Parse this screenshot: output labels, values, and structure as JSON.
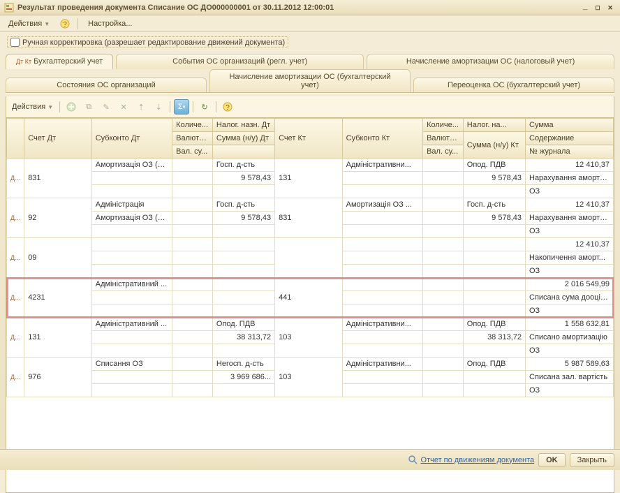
{
  "window": {
    "title": "Результат проведения документа Списание ОС ДО000000001 от 30.11.2012 12:00:01"
  },
  "menu": {
    "actions": "Действия",
    "settings": "Настройка..."
  },
  "manual_edit": {
    "label": "Ручная корректировка (разрешает редактирование движений документа)"
  },
  "tabs_row1": [
    {
      "label": "Бухгалтерский учет",
      "active": true,
      "badge": "Дт Кт"
    },
    {
      "label": "События ОС организаций (регл. учет)"
    },
    {
      "label": "Начисление амортизации ОС (налоговый учет)"
    }
  ],
  "tabs_row2": [
    {
      "label": "Состояния ОС организаций"
    },
    {
      "label": "Начисление амортизации ОС (бухгалтерский учет)"
    },
    {
      "label": "Переоценка ОС (бухгалтерский учет)"
    }
  ],
  "inner_actions": "Действия",
  "headers": {
    "r1": {
      "acc_dt": "Счет Дт",
      "sub_dt": "Субконто Дт",
      "qty": "Количе...",
      "tax_dt": "Налог. назн. Дт",
      "acc_kt": "Счет Кт",
      "sub_kt": "Субконто Кт",
      "qty2": "Количе...",
      "tax_na": "Налог. на...",
      "sum": "Сумма"
    },
    "r2": {
      "cur": "Валюта ...",
      "sum_nu": "Сумма (н/у) Дт",
      "cur2": "Валюта...",
      "sum_kt": "Сумма (н/у) Кт",
      "desc": "Содержание"
    },
    "r3": {
      "val": "Вал. су...",
      "val2": "Вал. су...",
      "journal": "№ журнала"
    }
  },
  "rows": [
    {
      "acc_dt": "831",
      "sub_dt1": "Амортизація ОЗ (А...",
      "tax_dt1": "Госп. д-сть",
      "sum_nu_dt": "9 578,43",
      "acc_kt": "131",
      "sub_kt1": "Адміністративни...",
      "tax_na": "Опод. ПДВ",
      "sum_kt": "9 578,43",
      "sum": "12 410,37",
      "desc": "Нарахування аморти...",
      "jour": "ОЗ"
    },
    {
      "acc_dt": "92",
      "sub_dt1": "Адміністрація",
      "sub_dt2": "Амортизація ОЗ (А...",
      "tax_dt1": "Госп. д-сть",
      "sum_nu_dt": "9 578,43",
      "acc_kt": "831",
      "sub_kt1": "Амортизація ОЗ ...",
      "tax_na": "Госп. д-сть",
      "sum_kt": "9 578,43",
      "sum": "12 410,37",
      "desc": "Нарахування аморти...",
      "jour": "ОЗ"
    },
    {
      "acc_dt": "09",
      "sum": "12 410,37",
      "desc": "Накопичення аморт...",
      "jour": "ОЗ"
    },
    {
      "acc_dt": "4231",
      "sub_dt1": "Адміністративний ...",
      "acc_kt": "441",
      "sum": "2 016 549,99",
      "desc": "Списана сума дооцін...",
      "jour": "ОЗ",
      "highlight": true
    },
    {
      "acc_dt": "131",
      "sub_dt1": "Адміністративний ...",
      "tax_dt1": "Опод. ПДВ",
      "sum_nu_dt": "38 313,72",
      "acc_kt": "103",
      "sub_kt1": "Адміністративни...",
      "tax_na": "Опод. ПДВ",
      "sum_kt": "38 313,72",
      "sum": "1 558 632,81",
      "desc": "Списано амортизацію",
      "jour": "ОЗ"
    },
    {
      "acc_dt": "976",
      "sub_dt1": "Списання ОЗ",
      "tax_dt1": "Негосп. д-сть",
      "sum_nu_dt": "3 969 686...",
      "acc_kt": "103",
      "sub_kt1": "Адміністративни...",
      "tax_na": "Опод. ПДВ",
      "sum": "5 987 589,63",
      "desc": "Списана зал. вартість",
      "jour": "ОЗ"
    }
  ],
  "footer": {
    "report": "Отчет по движениям документа",
    "ok": "OK",
    "close": "Закрыть"
  },
  "icons": {
    "dk": "Дт Кт"
  }
}
